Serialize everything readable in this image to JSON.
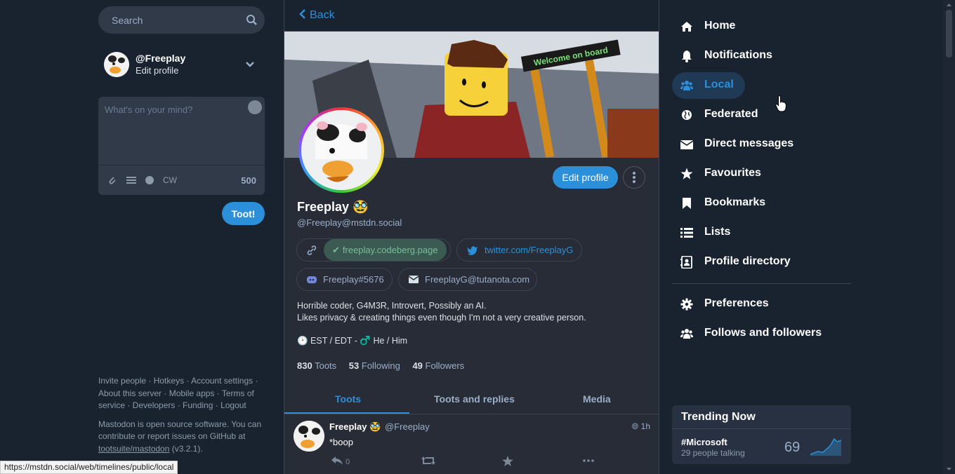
{
  "search": {
    "placeholder": "Search"
  },
  "me": {
    "handle": "@Freeplay",
    "edit_label": "Edit profile"
  },
  "compose": {
    "placeholder": "What's on your mind?",
    "cw_label": "CW",
    "char_count": "500",
    "submit_label": "Toot!"
  },
  "footer": {
    "line1": "Invite people · Hotkeys · Account settings ·",
    "line2": "About this server · Mobile apps · Terms of",
    "line3": "service · Developers · Funding · Logout",
    "about1": "Mastodon is open source software. You can",
    "about2": "contribute or report issues on GitHub at",
    "repo": "tootsuite/mastodon",
    "version": " (v3.2.1)."
  },
  "back_label": "Back",
  "header_sign": "Welcome on board",
  "profile": {
    "edit_label": "Edit profile",
    "display_name": "Freeplay 🥸",
    "account": "@Freeplay@mstdn.social",
    "fields": [
      {
        "value": "freeplay.codeberg.page"
      },
      {
        "value": "twitter.com/FreeplayG"
      },
      {
        "value": "Freeplay#5676"
      },
      {
        "value": "FreeplayG@tutanota.com"
      }
    ],
    "bio_line1": "Horrible coder, G4M3R, Introvert, Possibly an AI.",
    "bio_line2": "Likes privacy & creating things even though I'm not a very creative person.",
    "bio_line3": "🕑 EST / EDT - ♂️ He / Him",
    "toots_count": "830",
    "toots_label": "Toots",
    "following_count": "53",
    "following_label": "Following",
    "followers_count": "49",
    "followers_label": "Followers"
  },
  "tabs": [
    "Toots",
    "Toots and replies",
    "Media"
  ],
  "status": {
    "name": "Freeplay 🥸",
    "acct": "@Freeplay",
    "time": "1h",
    "text": "*boop",
    "reply_count": "0"
  },
  "nav": {
    "home": "Home",
    "notifications": "Notifications",
    "local": "Local",
    "federated": "Federated",
    "direct": "Direct messages",
    "favourites": "Favourites",
    "bookmarks": "Bookmarks",
    "lists": "Lists",
    "directory": "Profile directory",
    "preferences": "Preferences",
    "follows": "Follows and followers"
  },
  "trending": {
    "title": "Trending Now",
    "tag": "#Microsoft",
    "meta": "29 people talking",
    "count": "69"
  },
  "statusbar_url": "https://mstdn.social/web/timelines/public/local",
  "colors": {
    "accent": "#2b90d9",
    "background": "#192330",
    "panel": "#282c37"
  }
}
